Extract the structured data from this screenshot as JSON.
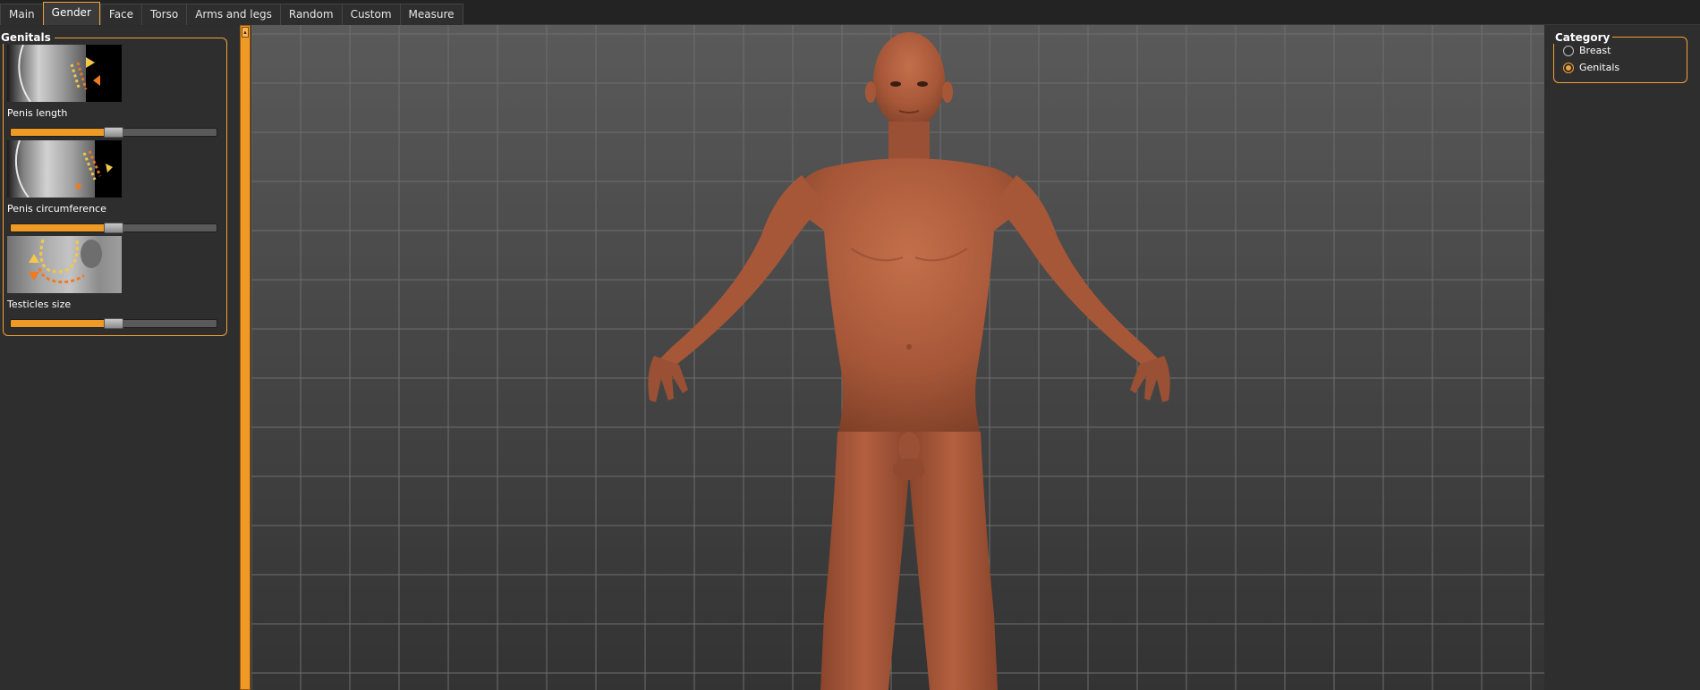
{
  "tabs": [
    {
      "label": "Main",
      "active": false
    },
    {
      "label": "Gender",
      "active": true
    },
    {
      "label": "Face",
      "active": false
    },
    {
      "label": "Torso",
      "active": false
    },
    {
      "label": "Arms and legs",
      "active": false
    },
    {
      "label": "Random",
      "active": false
    },
    {
      "label": "Custom",
      "active": false
    },
    {
      "label": "Measure",
      "active": false
    }
  ],
  "genitals": {
    "title": "Genitals",
    "modifiers": [
      {
        "label": "Penis length",
        "value": 0.5
      },
      {
        "label": "Penis circumference",
        "value": 0.5
      },
      {
        "label": "Testicles size",
        "value": 0.5
      }
    ]
  },
  "category": {
    "title": "Category",
    "options": [
      {
        "label": "Breast",
        "checked": false
      },
      {
        "label": "Genitals",
        "checked": true
      }
    ]
  },
  "colors": {
    "accent": "#f2a235",
    "slider_fill": "#f09a26",
    "skin": "#b0603f",
    "panel_bg": "#2e2e2e"
  }
}
